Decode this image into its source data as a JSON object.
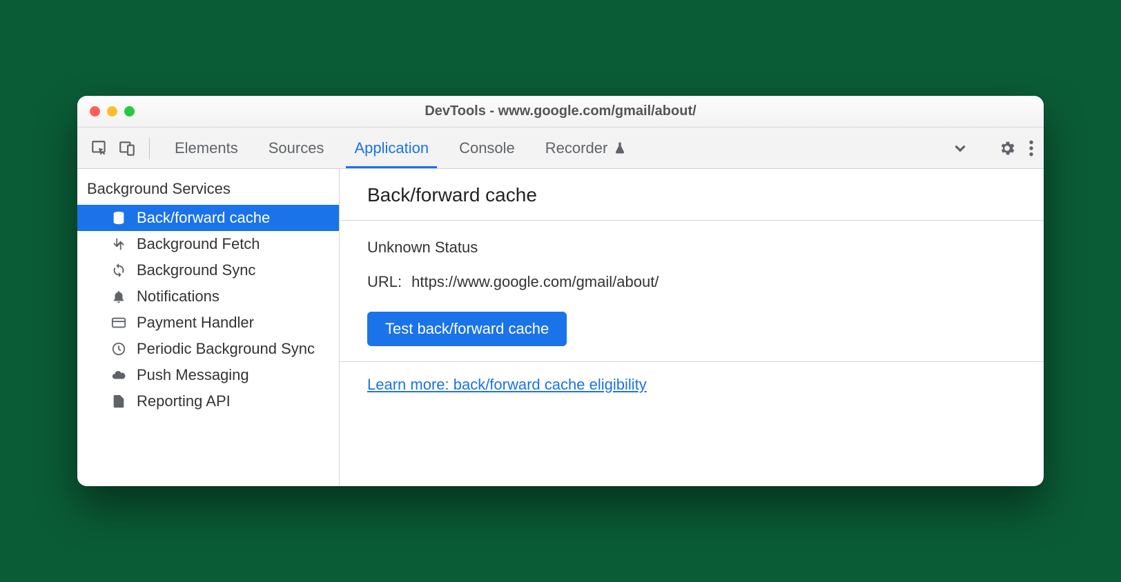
{
  "window": {
    "title": "DevTools - www.google.com/gmail/about/"
  },
  "tabs": {
    "elements": "Elements",
    "sources": "Sources",
    "application": "Application",
    "console": "Console",
    "recorder": "Recorder"
  },
  "sidebar": {
    "header": "Background Services",
    "items": [
      {
        "label": "Back/forward cache",
        "icon": "database-icon",
        "selected": true
      },
      {
        "label": "Background Fetch",
        "icon": "fetch-icon"
      },
      {
        "label": "Background Sync",
        "icon": "sync-icon"
      },
      {
        "label": "Notifications",
        "icon": "bell-icon"
      },
      {
        "label": "Payment Handler",
        "icon": "card-icon"
      },
      {
        "label": "Periodic Background Sync",
        "icon": "clock-icon"
      },
      {
        "label": "Push Messaging",
        "icon": "cloud-icon"
      },
      {
        "label": "Reporting API",
        "icon": "file-icon"
      }
    ]
  },
  "main": {
    "title": "Back/forward cache",
    "status": "Unknown Status",
    "url_label": "URL:",
    "url_value": "https://www.google.com/gmail/about/",
    "button": "Test back/forward cache",
    "link": "Learn more: back/forward cache eligibility"
  }
}
